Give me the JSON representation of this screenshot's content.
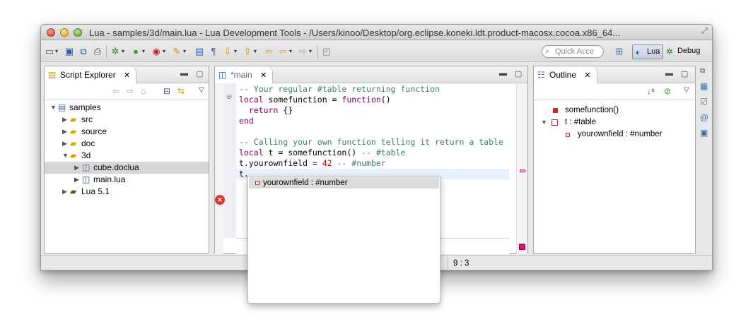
{
  "window": {
    "title": "Lua - samples/3d/main.lua - Lua Development Tools - /Users/kinoo/Desktop/org.eclipse.koneki.ldt.product-macosx.cocoa.x86_64..."
  },
  "toolbar": {
    "quick_access_placeholder": "Quick Acce",
    "perspectives": [
      {
        "label": "Lua",
        "icon": "lua-perspective-icon"
      },
      {
        "label": "Debug",
        "icon": "bug-icon"
      }
    ]
  },
  "script_explorer": {
    "tab_label": "Script Explorer",
    "tree": [
      {
        "label": "samples",
        "level": 0,
        "expanded": true,
        "icon": "project-icon"
      },
      {
        "label": "src",
        "level": 1,
        "expanded": false,
        "icon": "source-folder-icon"
      },
      {
        "label": "source",
        "level": 1,
        "expanded": false,
        "icon": "source-folder-icon"
      },
      {
        "label": "doc",
        "level": 1,
        "expanded": false,
        "icon": "source-folder-icon"
      },
      {
        "label": "3d",
        "level": 1,
        "expanded": true,
        "icon": "source-folder-icon"
      },
      {
        "label": "cube.doclua",
        "level": 2,
        "expanded": false,
        "icon": "doclua-file-icon",
        "selected": true
      },
      {
        "label": "main.lua",
        "level": 2,
        "expanded": false,
        "icon": "lua-file-icon"
      },
      {
        "label": "Lua 5.1",
        "level": 1,
        "expanded": false,
        "icon": "library-icon"
      }
    ]
  },
  "editor": {
    "tab_label": "*main",
    "lines": [
      [
        {
          "t": "-- Your regular #table returning function",
          "c": "cm"
        }
      ],
      [
        {
          "t": "local",
          "c": "kw"
        },
        {
          "t": " somefunction = ",
          "c": ""
        },
        {
          "t": "function",
          "c": "kw"
        },
        {
          "t": "()",
          "c": ""
        }
      ],
      [
        {
          "t": "  ",
          "c": ""
        },
        {
          "t": "return",
          "c": "kw"
        },
        {
          "t": " {}",
          "c": ""
        }
      ],
      [
        {
          "t": "end",
          "c": "kw"
        }
      ],
      [
        {
          "t": "",
          "c": ""
        }
      ],
      [
        {
          "t": "-- Calling your own function telling it return a table",
          "c": "cm"
        }
      ],
      [
        {
          "t": "local",
          "c": "kw"
        },
        {
          "t": " t = somefunction() ",
          "c": ""
        },
        {
          "t": "-- #table",
          "c": "cm"
        }
      ],
      [
        {
          "t": "t.yourownfield = ",
          "c": ""
        },
        {
          "t": "42",
          "c": "num"
        },
        {
          "t": " ",
          "c": ""
        },
        {
          "t": "-- #number",
          "c": "cm"
        }
      ],
      [
        {
          "t": "t.",
          "c": ""
        }
      ]
    ],
    "current_line": 8
  },
  "completion": {
    "items": [
      {
        "label": "yourownfield : #number",
        "icon": "field-icon"
      }
    ]
  },
  "outline": {
    "tab_label": "Outline",
    "items": [
      {
        "label": "somefunction()",
        "level": 0,
        "kind": "function",
        "expanded": false
      },
      {
        "label": "t : #table",
        "level": 0,
        "kind": "table",
        "expanded": true
      },
      {
        "label": "yourownfield : #number",
        "level": 1,
        "kind": "field",
        "expanded": false
      }
    ]
  },
  "statusbar": {
    "position": "9 : 3"
  }
}
